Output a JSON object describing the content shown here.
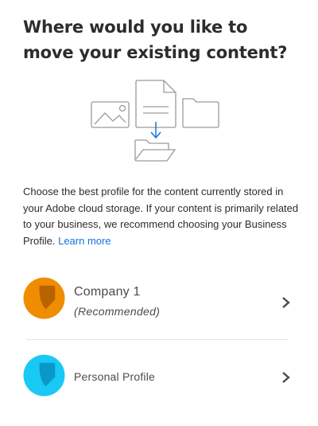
{
  "heading": "Where would you like to move your existing content?",
  "description": {
    "text": "Choose the best profile for the content currently stored in your Adobe cloud storage. If your content is primarily related to your business, we recommend choosing your Business Profile.",
    "link": "Learn more"
  },
  "profiles": [
    {
      "name": "Company 1",
      "subtitle": "(Recommended)",
      "color": "#f08c00",
      "accent": "#b86200",
      "icon": "chevron-right-icon"
    },
    {
      "name": "Personal Profile",
      "color": "#18c8f5",
      "accent": "#0a98c8",
      "icon": "chevron-right-icon"
    }
  ],
  "colors": {
    "link": "#1473e6",
    "illustration_stroke": "#9a9a9a",
    "arrow": "#1473e6"
  }
}
